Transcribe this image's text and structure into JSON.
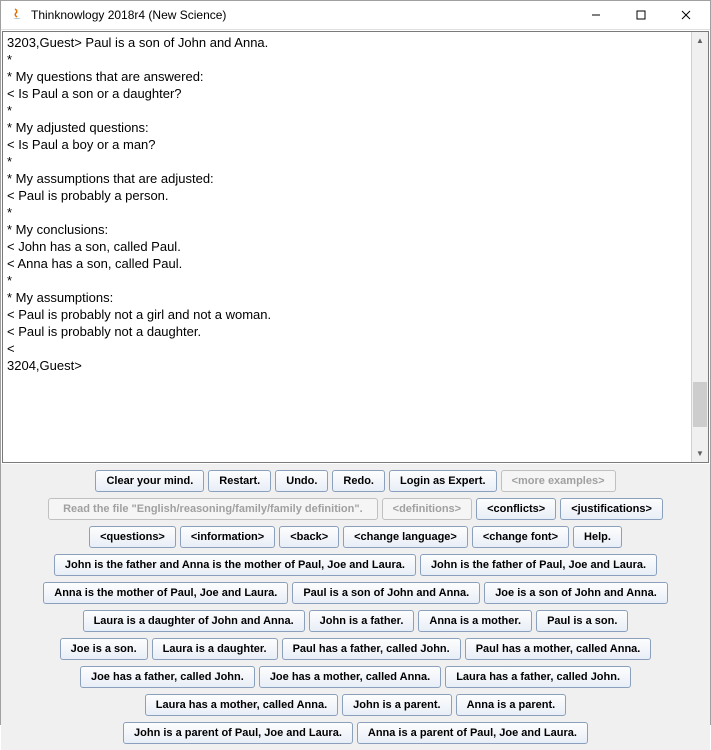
{
  "window": {
    "title": "Thinknowlogy 2018r4 (New Science)"
  },
  "console": {
    "text": "3203,Guest> Paul is a son of John and Anna.\n*\n* My questions that are answered:\n< Is Paul a son or a daughter?\n*\n* My adjusted questions:\n< Is Paul a boy or a man?\n*\n* My assumptions that are adjusted:\n< Paul is probably a person.\n*\n* My conclusions:\n< John has a son, called Paul.\n< Anna has a son, called Paul.\n*\n* My assumptions:\n< Paul is probably not a girl and not a woman.\n< Paul is probably not a daughter.\n<\n3204,Guest>"
  },
  "buttons": {
    "row1": [
      "Clear your mind.",
      "Restart.",
      "Undo.",
      "Redo.",
      "Login as Expert.",
      "<more examples>"
    ],
    "row2": [
      "Read the file \"English/reasoning/family/family definition\".",
      "<definitions>",
      "<conflicts>",
      "<justifications>"
    ],
    "row3": [
      "<questions>",
      "<information>",
      "<back>",
      "<change language>",
      "<change font>",
      "Help."
    ],
    "row4": [
      "John is the father and Anna is the mother of Paul, Joe and Laura.",
      "John is the father of Paul, Joe and Laura."
    ],
    "row5": [
      "Anna is the mother of Paul, Joe and Laura.",
      "Paul is a son of John and Anna.",
      "Joe is a son of John and Anna."
    ],
    "row6": [
      "Laura is a daughter of John and Anna.",
      "John is a father.",
      "Anna is a mother.",
      "Paul is a son."
    ],
    "row7": [
      "Joe is a son.",
      "Laura is a daughter.",
      "Paul has a father, called John.",
      "Paul has a mother, called Anna."
    ],
    "row8": [
      "Joe has a father, called John.",
      "Joe has a mother, called Anna.",
      "Laura has a father, called John."
    ],
    "row9": [
      "Laura has a mother, called Anna.",
      "John is a parent.",
      "Anna is a parent."
    ],
    "row10": [
      "John is a parent of Paul, Joe and Laura.",
      "Anna is a parent of Paul, Joe and Laura."
    ]
  }
}
